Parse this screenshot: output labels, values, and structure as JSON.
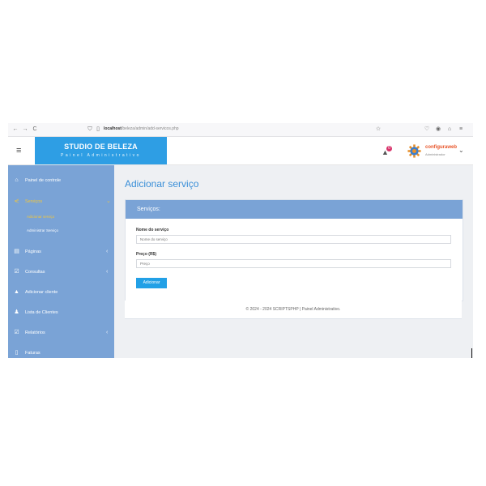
{
  "browser": {
    "back": "←",
    "forward": "→",
    "reload": "C",
    "url_host": "localhost",
    "url_path": "/beleza/admin/add-servicos.php"
  },
  "header": {
    "menu_glyph": "≡",
    "brand_title": "STUDIO DE BELEZA",
    "brand_subtitle": "Painel Administrativo",
    "notification_count": "0",
    "user_name": "configuraweb",
    "user_role": "Administrador"
  },
  "sidebar": {
    "items": [
      {
        "label": "Painel de controle",
        "icon": "home-icon",
        "glyph": "⌂"
      },
      {
        "label": "Serviços",
        "icon": "share-icon",
        "glyph": "⋞"
      },
      {
        "label": "Páginas",
        "icon": "files-icon",
        "glyph": "▤"
      },
      {
        "label": "Consultas",
        "icon": "check-square-icon",
        "glyph": "☑"
      },
      {
        "label": "Adicionar cliente",
        "icon": "user-icon",
        "glyph": "▲"
      },
      {
        "label": "Lista de Clientes",
        "icon": "users-icon",
        "glyph": "♟"
      },
      {
        "label": "Relatórios",
        "icon": "check-square-icon",
        "glyph": "☑"
      },
      {
        "label": "Faturas",
        "icon": "file-icon",
        "glyph": "▯"
      }
    ],
    "sub_items": [
      "Adicionar serviço",
      "Administrar Serviço"
    ]
  },
  "main": {
    "page_title": "Adicionar serviço",
    "card_title": "Serviços:",
    "name_label": "Nome do serviço",
    "name_placeholder": "Nome do serviço",
    "price_label": "Preço (R$)",
    "price_placeholder": "Preço",
    "submit_label": "Adicionar",
    "footer": "© 2024 - 2024 SCRIPTSPHP | Painel Administrativo."
  },
  "colors": {
    "brand": "#2e9ee4",
    "sidebar": "#7aa3d6",
    "active_item": "#f3c63a",
    "title": "#3a8fd8",
    "badge": "#d8326a",
    "user_name": "#e8552a"
  }
}
